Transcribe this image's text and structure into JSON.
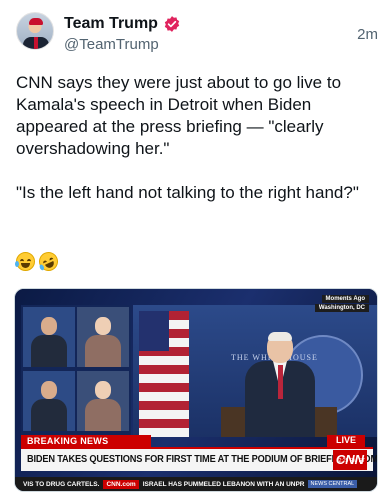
{
  "post": {
    "display_name": "Team Trump",
    "handle": "@TeamTrump",
    "timestamp": "2m",
    "verified_icon": "verified-badge-icon",
    "body": "CNN says they were just about to go live to Kamala's speech in Detroit when Biden appeared at the press briefing — \"clearly overshadowing her.\"\n\n\"Is the left hand not talking to the right hand?\"",
    "emojis": [
      "face-with-tears-of-joy",
      "rolling-on-the-floor-laughing"
    ]
  },
  "media": {
    "moments_ago": "Moments Ago",
    "location": "Washington, DC",
    "wall_text": "THE WHITE HOUSE",
    "breaking_label": "BREAKING NEWS",
    "live_label": "LIVE",
    "headline": "BIDEN TAKES QUESTIONS FOR FIRST TIME AT THE PODIUM OF BRIEFING ROOM",
    "network_logo": "CNN",
    "clock": "2:25 PM ET",
    "ticker_left": "VIS TO DRUG CARTELS.",
    "ticker_logo": "CNN.com",
    "ticker_right": "ISRAEL HAS PUMMELED LEBANON WITH AN UNPR",
    "ticker_tag": "NEWS CENTRAL"
  },
  "colors": {
    "verified": "#e0245e",
    "cnn_red": "#cc0000",
    "text_secondary": "#536471"
  }
}
